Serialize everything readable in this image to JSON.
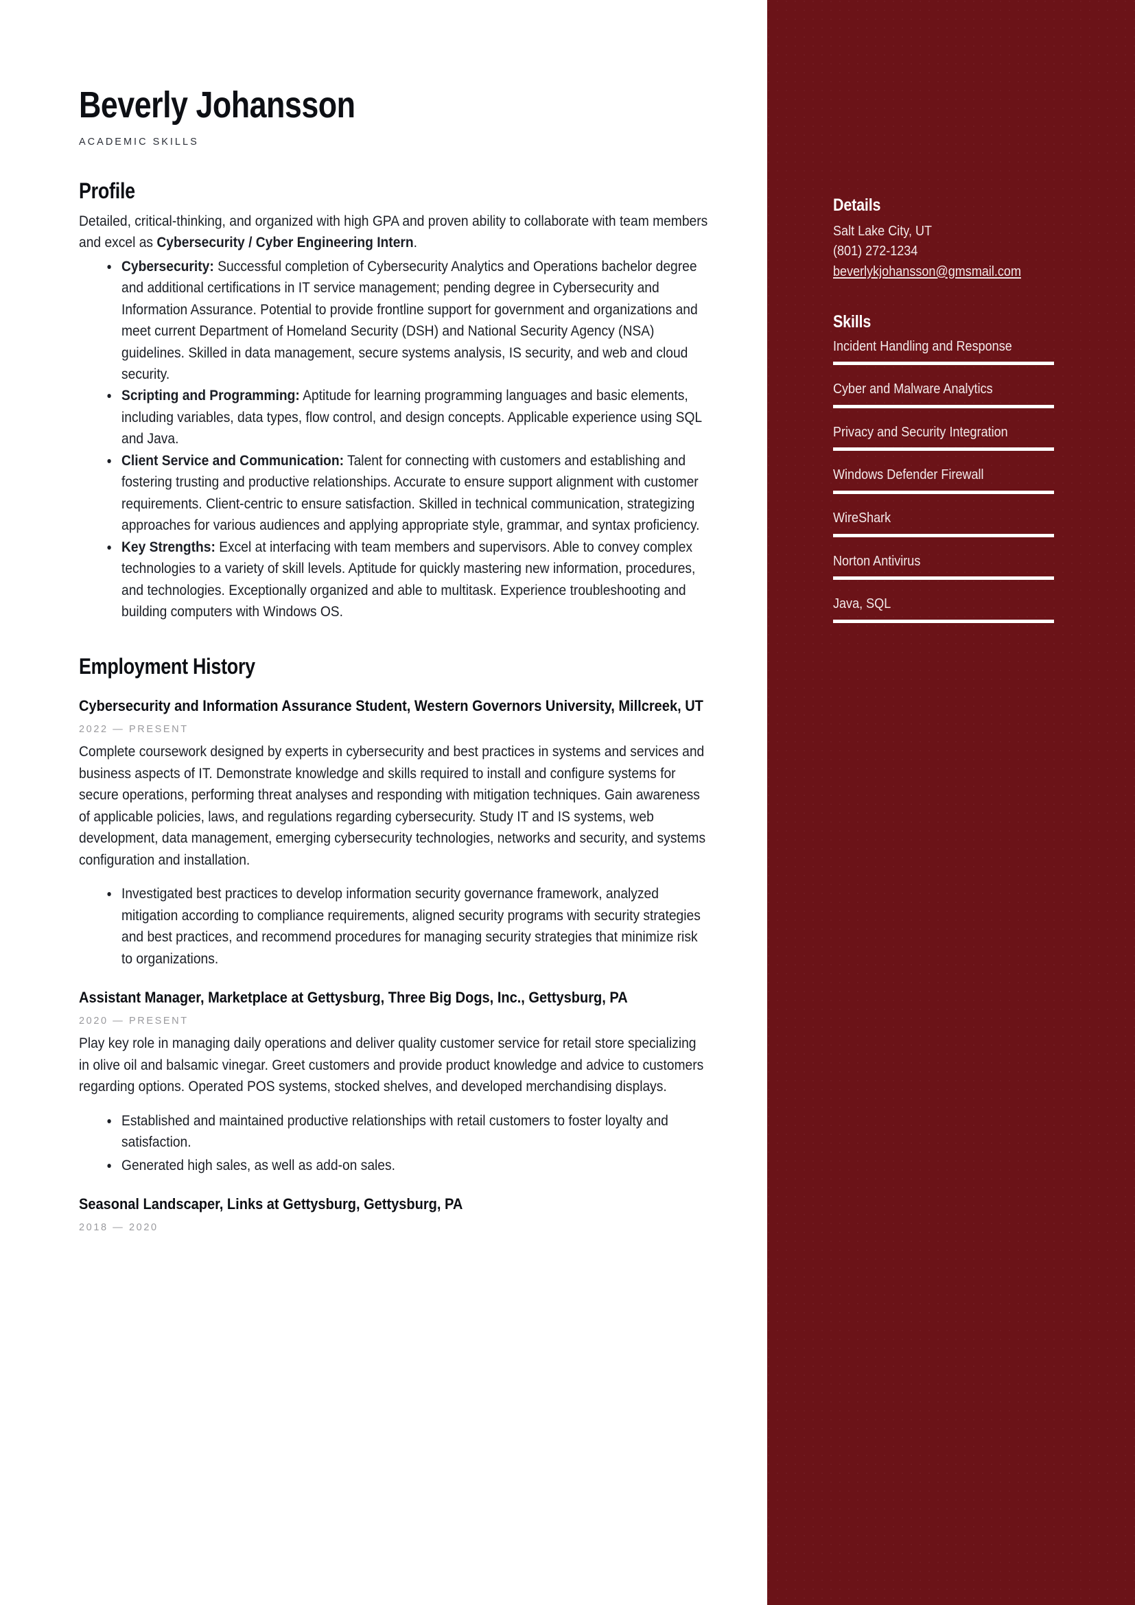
{
  "header": {
    "name": "Beverly Johansson",
    "subtitle": "ACADEMIC SKILLS"
  },
  "profile": {
    "title": "Profile",
    "intro_pre": "Detailed, critical-thinking, and organized with high GPA and proven ability to collaborate with team members and excel as ",
    "intro_bold": "Cybersecurity / Cyber Engineering Intern",
    "intro_post": ".",
    "bullets": [
      {
        "lead": "Cybersecurity:",
        "text": " Successful completion of Cybersecurity Analytics and Operations bachelor degree and additional certifications in IT service management; pending degree in Cybersecurity and Information Assurance. Potential to provide frontline support for government and organizations and meet current Department of Homeland Security (DSH) and National Security Agency (NSA) guidelines. Skilled in data management, secure systems analysis, IS security, and web and cloud security."
      },
      {
        "lead": "Scripting and Programming:",
        "text": " Aptitude for learning programming languages and basic elements, including variables, data types, flow control, and design concepts. Applicable experience using SQL and Java."
      },
      {
        "lead": "Client Service and Communication:",
        "text": " Talent for connecting with customers and establishing and fostering trusting and productive relationships. Accurate to ensure support alignment with customer requirements. Client-centric to ensure satisfaction. Skilled in technical communication, strategizing approaches for various audiences and applying appropriate style, grammar, and syntax proficiency."
      },
      {
        "lead": "Key Strengths:",
        "text": " Excel at interfacing with team members and supervisors. Able to convey complex technologies to a variety of skill levels. Aptitude for quickly mastering new information, procedures, and technologies. Exceptionally organized and able to multitask. Experience troubleshooting and building computers with Windows OS."
      }
    ]
  },
  "employment": {
    "title": "Employment History",
    "jobs": [
      {
        "title": "Cybersecurity and Information Assurance Student, Western Governors University,  Millcreek, UT",
        "date": "2022 — PRESENT",
        "description": "Complete coursework designed by experts in cybersecurity and best practices in systems and services and business aspects of IT. Demonstrate knowledge and skills required to install and configure systems for secure operations, performing threat analyses and responding with mitigation techniques. Gain awareness of applicable policies, laws, and regulations regarding cybersecurity. Study IT and IS systems, web development, data management, emerging cybersecurity technologies, networks and security, and systems configuration and installation.",
        "bullets": [
          "Investigated best practices to develop information security governance framework, analyzed mitigation according to compliance requirements, aligned security programs with security strategies and best practices, and recommend procedures for managing security strategies that minimize risk to organizations."
        ]
      },
      {
        "title": "Assistant Manager, Marketplace at Gettysburg, Three Big Dogs, Inc., Gettysburg, PA",
        "date": "2020 — PRESENT",
        "description": "Play key role in managing daily operations and deliver quality customer service for retail store specializing in olive oil and balsamic vinegar. Greet customers and provide product knowledge and advice to customers regarding options. Operated POS systems, stocked shelves, and developed merchandising displays.",
        "bullets": [
          "Established and maintained productive relationships with retail customers to foster loyalty and satisfaction.",
          "Generated high sales, as well as add-on sales."
        ]
      },
      {
        "title": "Seasonal Landscaper, Links at Gettysburg, Gettysburg, PA",
        "date": "2018 — 2020",
        "description": "",
        "bullets": []
      }
    ]
  },
  "sidebar": {
    "details": {
      "title": "Details",
      "location": "Salt Lake City, UT",
      "phone": "(801) 272-1234",
      "email": "beverlykjohansson@gmsmail.com"
    },
    "skills": {
      "title": "Skills",
      "items": [
        {
          "name": "Incident Handling and Response",
          "level": 100
        },
        {
          "name": "Cyber and Malware Analytics",
          "level": 100
        },
        {
          "name": "Privacy and Security Integration",
          "level": 100
        },
        {
          "name": "Windows Defender Firewall",
          "level": 100
        },
        {
          "name": "WireShark",
          "level": 100
        },
        {
          "name": "Norton Antivirus",
          "level": 100
        },
        {
          "name": "Java, SQL",
          "level": 100
        }
      ]
    }
  },
  "colors": {
    "sidebar_bg": "#6B1318",
    "text_dark": "#1b1e25",
    "date_gray": "#9a9a9e",
    "sidebar_text": "#f3eaea"
  }
}
